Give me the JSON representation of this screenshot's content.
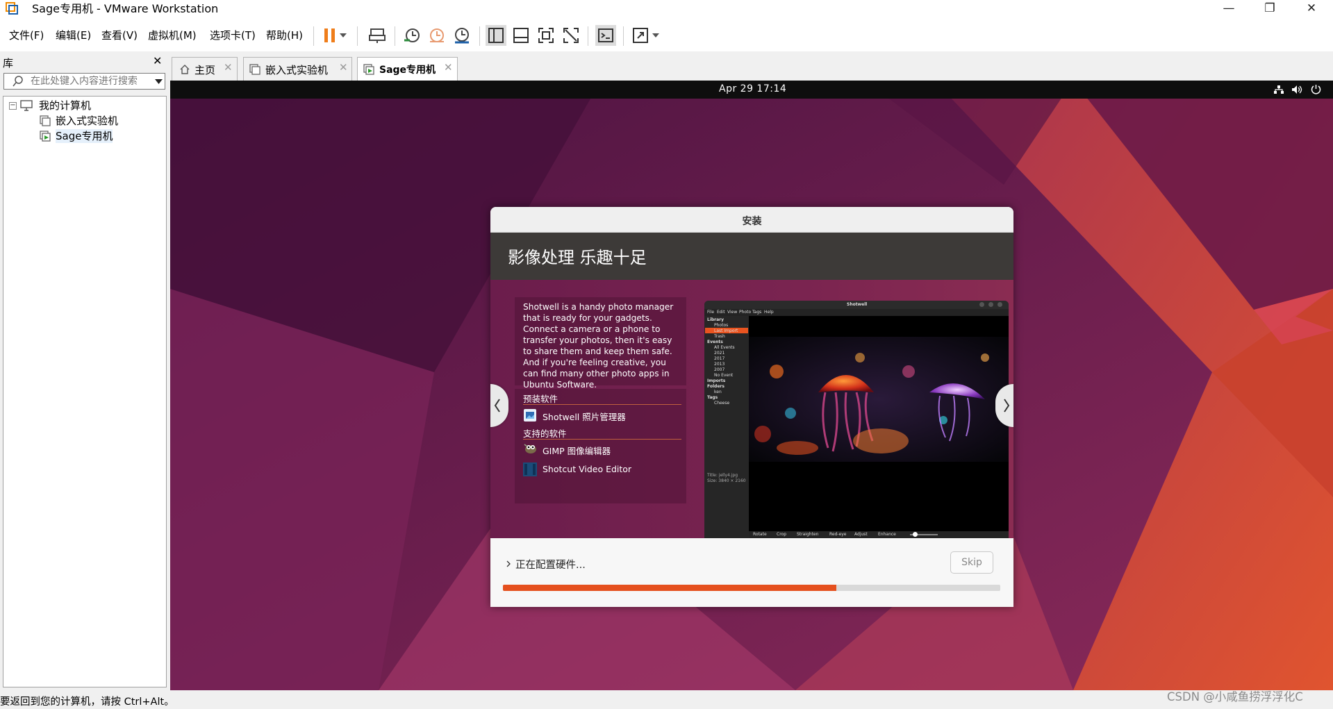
{
  "window": {
    "title": "Sage专用机 - VMware Workstation",
    "minimize_icon": "minimize-icon",
    "restore_icon": "restore-icon",
    "close_icon": "close-icon"
  },
  "menu": [
    "文件(F)",
    "编辑(E)",
    "查看(V)",
    "虚拟机(M)",
    "选项卡(T)",
    "帮助(H)"
  ],
  "library": {
    "title": "库",
    "close": "✕",
    "search_placeholder": "在此处键入内容进行搜索",
    "tree": {
      "root": "我的计算机",
      "items": [
        "嵌入式实验机",
        "Sage专用机"
      ]
    }
  },
  "tabs": [
    {
      "label": "主页",
      "icon": "home-icon"
    },
    {
      "label": "嵌入式实验机",
      "icon": "vm-icon"
    },
    {
      "label": "Sage专用机",
      "icon": "vm-running-icon",
      "active": true
    }
  ],
  "guest": {
    "clock": "Apr 29  17:14",
    "installer": {
      "title": "安装",
      "heading": "影像处理 乐趣十足",
      "description": "Shotwell is a handy photo manager that is ready for your gadgets. Connect a camera or a phone to transfer your photos, then it's easy to share them and keep them safe. And if you're feeling creative, you can find many other photo apps in Ubuntu Software.",
      "preinstalled_label": "预装软件",
      "preinstalled": [
        "Shotwell 照片管理器"
      ],
      "supported_label": "支持的软件",
      "supported": [
        "GIMP 图像编辑器",
        "Shotcut Video Editor"
      ],
      "shotwell": {
        "title": "Shotwell",
        "menu": [
          "File",
          "Edit",
          "View",
          "Photo",
          "Tags",
          "Help"
        ],
        "sidebar": [
          "Library",
          "Photos",
          "Last Import",
          "Trash",
          "Events",
          "All Events",
          "2021",
          "2017",
          "2013",
          "2007",
          "No Event",
          "Imports",
          "Folders",
          "ken",
          "Tags",
          "Cheese"
        ],
        "info_title": "Title:  jelly4.jpg",
        "info_size": "Size:   3840 × 2160",
        "tools": [
          "Rotate",
          "Crop",
          "Straighten",
          "Red-eye",
          "Adjust",
          "Enhance"
        ]
      },
      "status": "正在配置硬件...",
      "skip": "Skip",
      "progress": 0.67
    }
  },
  "statusbar": {
    "hint": "要返回到您的计算机，请按 Ctrl+Alt。"
  },
  "watermark": "CSDN @小咸鱼捞浮浮化C",
  "colors": {
    "accent": "#e5501e",
    "installer_band": "#3d3a38",
    "slide_bg": "#7a2450"
  }
}
